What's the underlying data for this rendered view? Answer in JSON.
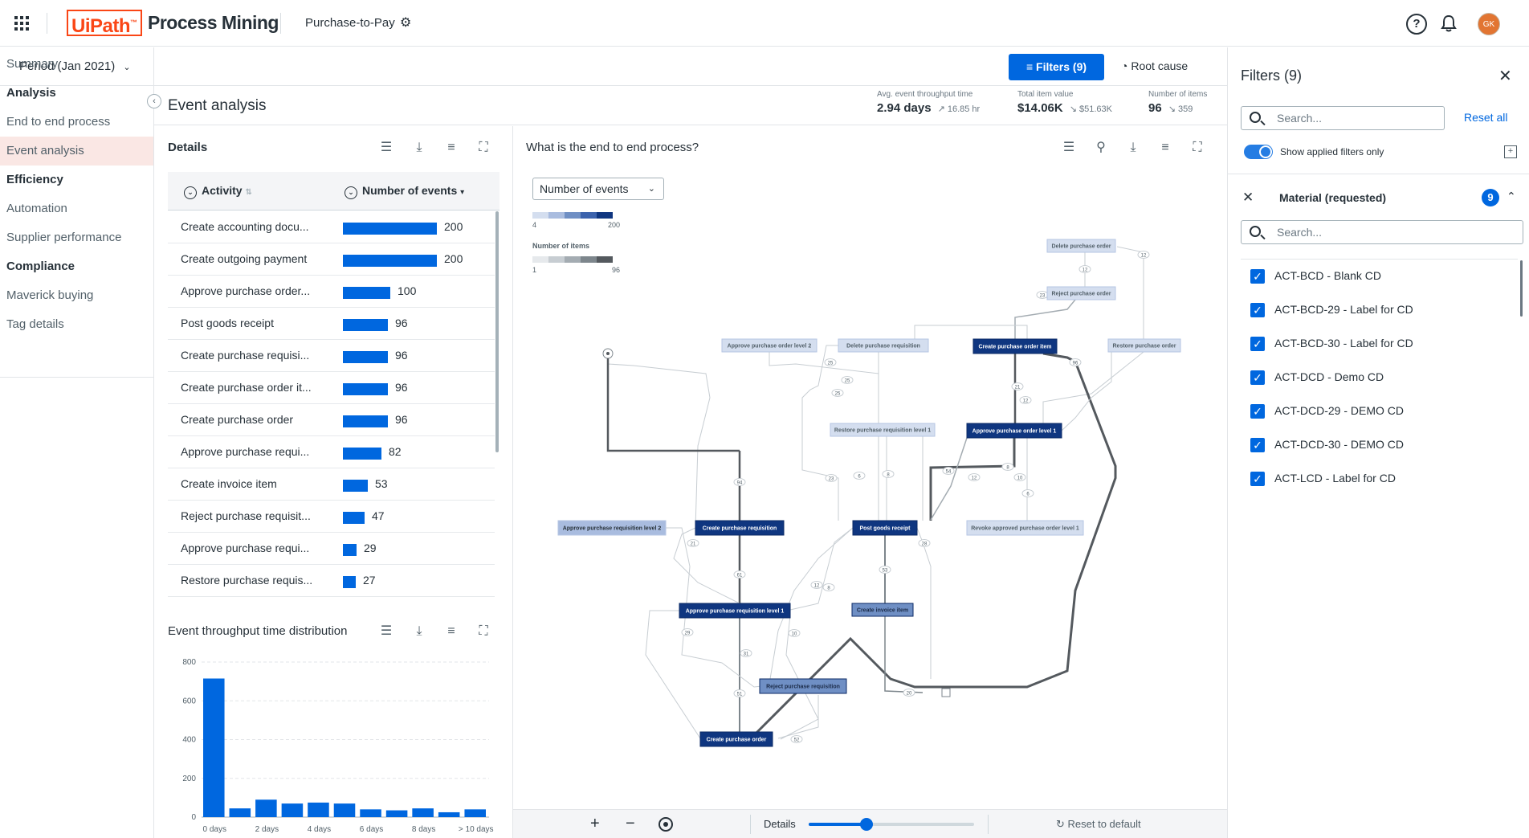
{
  "header": {
    "brand_logo": "UiPath",
    "brand_tm": "™",
    "product": "Process Mining",
    "app": "Purchase-to-Pay",
    "help": "?",
    "avatar": "GK"
  },
  "period": "Period (Jan 2021)",
  "toolbar": {
    "filters": "Filters (9)",
    "root_cause": "Root cause"
  },
  "nav": [
    {
      "label": "Summary",
      "section": false
    },
    {
      "label": "Analysis",
      "section": true
    },
    {
      "label": "End to end process",
      "section": false
    },
    {
      "label": "Event analysis",
      "section": false,
      "active": true
    },
    {
      "label": "Efficiency",
      "section": true
    },
    {
      "label": "Automation",
      "section": false
    },
    {
      "label": "Supplier performance",
      "section": false
    },
    {
      "label": "Compliance",
      "section": true
    },
    {
      "label": "Maverick buying",
      "section": false
    },
    {
      "label": "Tag details",
      "section": false
    }
  ],
  "page_title": "Event analysis",
  "kpis": [
    {
      "label": "Avg. event throughput time",
      "value": "2.94 days",
      "delta": "16.85 hr"
    },
    {
      "label": "Total item value",
      "value": "$14.06K",
      "delta": "$51.63K"
    },
    {
      "label": "Number of items",
      "value": "96",
      "delta": "359"
    }
  ],
  "details": {
    "title": "Details",
    "col_activity": "Activity",
    "col_events": "Number of events",
    "rows": [
      {
        "activity": "Create accounting docu...",
        "events": 200
      },
      {
        "activity": "Create outgoing payment",
        "events": 200
      },
      {
        "activity": "Approve purchase order...",
        "events": 100
      },
      {
        "activity": "Post goods receipt",
        "events": 96
      },
      {
        "activity": "Create purchase requisi...",
        "events": 96
      },
      {
        "activity": "Create purchase order it...",
        "events": 96
      },
      {
        "activity": "Create purchase order",
        "events": 96
      },
      {
        "activity": "Approve purchase requi...",
        "events": 82
      },
      {
        "activity": "Create invoice item",
        "events": 53
      },
      {
        "activity": "Reject purchase requisit...",
        "events": 47
      },
      {
        "activity": "Approve purchase requi...",
        "events": 29
      },
      {
        "activity": "Restore purchase requis...",
        "events": 27
      }
    ]
  },
  "chart_data": {
    "type": "bar",
    "title": "Event throughput time distribution",
    "categories": [
      "0 days",
      "",
      "2 days",
      "",
      "4 days",
      "",
      "6 days",
      "",
      "8 days",
      "",
      "> 10 days"
    ],
    "values": [
      715,
      45,
      90,
      70,
      75,
      70,
      40,
      35,
      45,
      25,
      40
    ],
    "ylim": [
      0,
      800
    ],
    "yticks": [
      0,
      200,
      400,
      600,
      800
    ],
    "grid": true
  },
  "process": {
    "title": "What is the end to end process?",
    "metric_select": "Number of events",
    "legend_events": {
      "min": "4",
      "max": "200"
    },
    "legend_items": {
      "label": "Number of items",
      "min": "1",
      "max": "96"
    },
    "nodes": [
      {
        "id": "n1",
        "label": "Delete purchase order",
        "shade": 1
      },
      {
        "id": "n2",
        "label": "Reject purchase order",
        "shade": 1
      },
      {
        "id": "n3",
        "label": "Approve purchase order level 2",
        "shade": 1
      },
      {
        "id": "n4",
        "label": "Delete purchase requisition",
        "shade": 1
      },
      {
        "id": "n5",
        "label": "Create purchase order item",
        "shade": 4
      },
      {
        "id": "n6",
        "label": "Restore purchase order",
        "shade": 1
      },
      {
        "id": "n7",
        "label": "Restore purchase requisition level 1",
        "shade": 1
      },
      {
        "id": "n8",
        "label": "Approve purchase order level 1",
        "shade": 4
      },
      {
        "id": "n9",
        "label": "Approve purchase requisition level 2",
        "shade": 2
      },
      {
        "id": "n10",
        "label": "Create purchase requisition",
        "shade": 4
      },
      {
        "id": "n11",
        "label": "Post goods receipt",
        "shade": 4
      },
      {
        "id": "n12",
        "label": "Revoke approved purchase order level 1",
        "shade": 1
      },
      {
        "id": "n13",
        "label": "Approve purchase requisition level 1",
        "shade": 4
      },
      {
        "id": "n14",
        "label": "Create invoice item",
        "shade": 3
      },
      {
        "id": "n15",
        "label": "Reject purchase requisition",
        "shade": 3
      },
      {
        "id": "n16",
        "label": "Create purchase order",
        "shade": 4
      }
    ],
    "edge_labels": [
      "12",
      "12",
      "23",
      "25",
      "25",
      "25",
      "21",
      "12",
      "96",
      "23",
      "6",
      "8",
      "54",
      "12",
      "8",
      "10",
      "6",
      "28",
      "94",
      "21",
      "61",
      "12",
      "8",
      "53",
      "29",
      "10",
      "31",
      "51",
      "52",
      "20"
    ]
  },
  "footer": {
    "plus": "+",
    "minus": "−",
    "details": "Details",
    "reset": "Reset to default"
  },
  "filters": {
    "title": "Filters (9)",
    "search_placeholder": "Search...",
    "reset_all": "Reset all",
    "toggle_label": "Show applied filters only",
    "group": {
      "title": "Material (requested)",
      "count": "9",
      "search_placeholder": "Search..."
    },
    "items": [
      "ACT-BCD - Blank CD",
      "ACT-BCD-29 - Label for CD",
      "ACT-BCD-30 - Label for CD",
      "ACT-DCD - Demo CD",
      "ACT-DCD-29 - DEMO CD",
      "ACT-DCD-30 - DEMO CD",
      "ACT-LCD - Label for CD"
    ]
  },
  "colors": {
    "accent": "#0067df",
    "brand": "#fa4616",
    "node_dark": "#0f3680",
    "node_mid": "#6f8fc4",
    "node_light": "#d4deef"
  }
}
